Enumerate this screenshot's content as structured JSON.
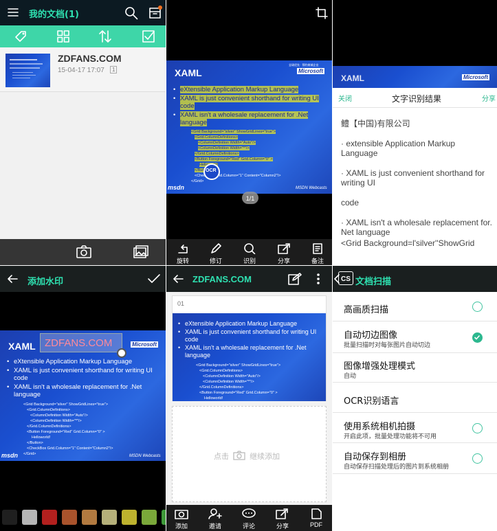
{
  "doc_list": {
    "title": "我的文档(1)",
    "doc_name": "ZDFANS.COM",
    "doc_date": "15-04-17 17:07",
    "doc_pages": "1"
  },
  "slide": {
    "title": "XAML",
    "brand": "Microsoft",
    "tagline": "全球优先 · 预约商城企业",
    "bullets": [
      "eXtensible Application Markup Language",
      "XAML is just convenient shorthand for writing UI code",
      "XAML isn't a wholesale replacement for .Net language"
    ],
    "code": [
      "<Grid Background=\"silver\" ShowGridLines=\"true\">",
      "<Grid.ColumnDefinitions>",
      "<ColumnDefinition Width=\"Auto\"/>",
      "<ColumnDefinition Width=\"*\"/>",
      "</Grid.ColumnDefinitions>",
      "<Button Foreground=\"Red\" Grid.Column=\"0\" >",
      "Helloworld!",
      "</Button>",
      "<CheckBox Grid.Column=\"1\" Content=\"Column2\"/>",
      "</Grid>"
    ],
    "msdn": "msdn",
    "webcasts": "MSDN Webcasts"
  },
  "viewer": {
    "page_indicator": "1/1",
    "ocr_badge": "OCR",
    "toolbar": [
      "旋转",
      "修订",
      "识别",
      "分享",
      "备注"
    ],
    "ocr_icon_text": "OCR"
  },
  "ocr_result": {
    "close": "关闭",
    "title": "文字识别结果",
    "share": "分享",
    "lines": [
      "鳢【中国)有限公司",
      "· extensible Application Markup Language",
      "· XAML is just convenient shorthand for writing UI",
      "code",
      "· XAML isn't a wholesale replacement for. Net language",
      "<Grid Background=l'silver''ShowGrid"
    ]
  },
  "watermark": {
    "title": "添加水印",
    "text": "ZDFANS.COM",
    "colors": [
      "#1f1f1f",
      "#b5b5b5",
      "#b3201e",
      "#a9532c",
      "#b27a40",
      "#b5b07a",
      "#bdb22e",
      "#7aa83a",
      "#3f9a3a"
    ]
  },
  "editor": {
    "title": "ZDFANS.COM",
    "page_no": "01",
    "add_hint_before": "点击",
    "add_hint_after": "继续添加",
    "toolbar": [
      "添加",
      "邀请",
      "评论",
      "分享",
      "PDF"
    ]
  },
  "settings": {
    "logo": "CS",
    "title": "文档扫描",
    "items": [
      {
        "title": "高画质扫描",
        "sub": "",
        "checked": false
      },
      {
        "title": "自动切边图像",
        "sub": "批量扫描时对每张图片自动切边",
        "checked": true
      },
      {
        "title": "图像增强处理模式",
        "sub": "自动",
        "checked": null
      },
      {
        "title": "OCR识别语言",
        "sub": "",
        "checked": null
      },
      {
        "title": "使用系统相机拍摄",
        "sub": "开启此项，批量处理功能将不可用",
        "checked": false
      },
      {
        "title": "自动保存到相册",
        "sub": "自动保存扫描处理后的图片到系统相册",
        "checked": false
      }
    ]
  },
  "colors": {
    "teal_dark": "#0b6a5a",
    "teal_bar": "#3ed6a8",
    "accent_green": "#2db88f",
    "slide_blue": "#1f4fd0"
  }
}
